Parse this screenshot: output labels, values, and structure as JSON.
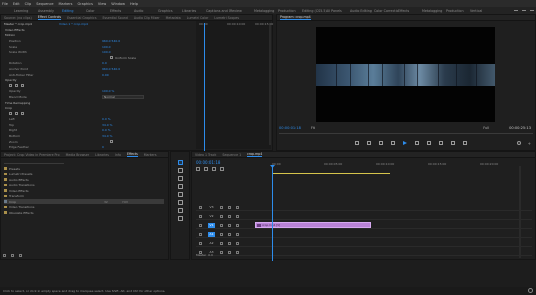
{
  "menu": [
    "File",
    "Edit",
    "Clip",
    "Sequence",
    "Markers",
    "Graphics",
    "View",
    "Window",
    "Help"
  ],
  "workspaces": [
    "Learning",
    "Assembly",
    "Editing",
    "Color",
    "Effects",
    "Audio",
    "Graphics",
    "Libraries",
    "Captions and Graphics",
    "Review",
    "Metalogging",
    "Production",
    "Editing (CS5.5)",
    "All Panels",
    "Audio Editing",
    "Color Correction",
    "Effects",
    "Metalogging",
    "Production",
    "Vertical"
  ],
  "workspace_active": 2,
  "effect_controls": {
    "tabs": [
      "Source: (no clips)",
      "Effect Controls",
      "Essential Graphics",
      "Essential Sound",
      "Audio Clip Mixer",
      "Metadata",
      "Lumetri Color",
      "Lumetri Scopes"
    ],
    "active_tab": 1,
    "header": "Master * crop.mp4",
    "clip_label": "Video 1 * crop.mp4",
    "rows": [
      {
        "label": "Video Effects",
        "top": true
      },
      {
        "label": "Motion",
        "top": true
      },
      {
        "label": "Position",
        "value": "960.0  540.0"
      },
      {
        "label": "Scale",
        "value": "100.0"
      },
      {
        "label": "Scale Width",
        "value": "100.0"
      },
      {
        "label": "",
        "check": true,
        "check_label": "Uniform Scale"
      },
      {
        "label": "Rotation",
        "value": "0.0"
      },
      {
        "label": "Anchor Point",
        "value": "960.0  540.0"
      },
      {
        "label": "Anti-flicker Filter",
        "value": "0.00"
      },
      {
        "label": "Opacity",
        "top": true
      },
      {
        "label": "",
        "shapes": true
      },
      {
        "label": "Opacity",
        "value": "100.0 %"
      },
      {
        "label": "Blend Mode",
        "select": "Normal"
      },
      {
        "label": "Time Remapping",
        "top": true
      },
      {
        "label": "Crop",
        "top": true
      },
      {
        "label": "",
        "shapes": true
      },
      {
        "label": "Left",
        "value": "0.0 %"
      },
      {
        "label": "Top",
        "value": "34.0 %"
      },
      {
        "label": "Right",
        "value": "0.0 %"
      },
      {
        "label": "Bottom",
        "value": "34.0 %"
      },
      {
        "label": "Zoom",
        "check": true,
        "check_label": ""
      },
      {
        "label": "Edge Feather",
        "value": "0"
      }
    ],
    "ruler": [
      "00:00",
      "00:00:10:00",
      "00:00:15:00"
    ]
  },
  "program": {
    "title": "Program: crop.mp4",
    "timecode": "00:00:01:18",
    "fit": "Fit",
    "quality": "Full",
    "duration": "00:00:25:13"
  },
  "project": {
    "tabs": [
      "Project: Crop Video in Premiere Pro",
      "Media Browser",
      "Libraries",
      "Info",
      "Effects",
      "Markers"
    ],
    "active_tab": 4,
    "items": [
      {
        "name": "Presets",
        "folder": true
      },
      {
        "name": "Lumetri Presets",
        "folder": true
      },
      {
        "name": "Audio Effects",
        "folder": true
      },
      {
        "name": "Audio Transitions",
        "folder": true
      },
      {
        "name": "Video Effects",
        "folder": true
      },
      {
        "name": "Transform",
        "folder": true
      },
      {
        "name": "Crop",
        "folder": false,
        "selected": true,
        "meta": "32",
        "meta2": "YUV"
      },
      {
        "name": "Video Transitions",
        "folder": true
      },
      {
        "name": "Obsolete Effects",
        "folder": true
      }
    ]
  },
  "timeline": {
    "tabs": [
      "Video 1 Track",
      "Sequence 1",
      "crop.mp4"
    ],
    "active_tab": 2,
    "timecode": "00:00:01:18",
    "ruler": [
      "00:00",
      "00:00:05:00",
      "00:00:10:00",
      "00:00:15:00",
      "00:00:20:00"
    ],
    "tracks": [
      {
        "name": "V3",
        "on": false
      },
      {
        "name": "V2",
        "on": false
      },
      {
        "name": "V1",
        "on": true
      },
      {
        "name": "A1",
        "on": true
      },
      {
        "name": "A2",
        "on": false
      },
      {
        "name": "A3",
        "on": false
      }
    ],
    "clip_label": "crop.mp4 [V]",
    "master": "Master",
    "master_value": "0.0"
  },
  "status": "Click to select, or click in empty space and drag to marquee select. Use Shift, Alt, and Ctrl for other options."
}
